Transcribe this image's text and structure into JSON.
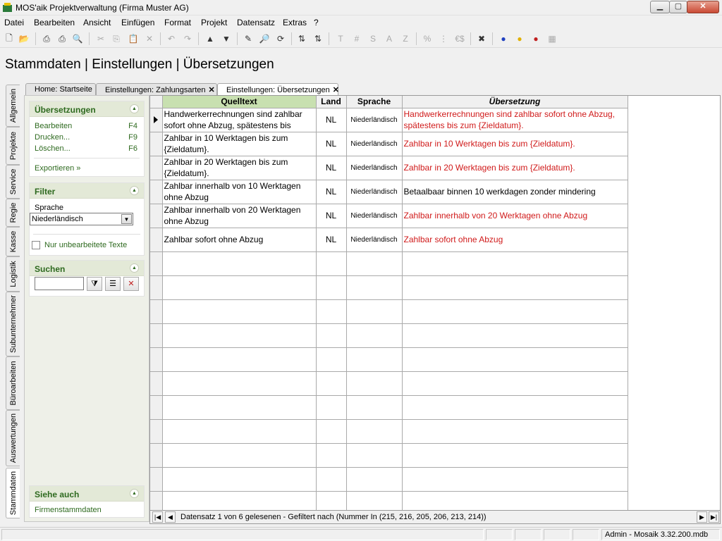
{
  "window": {
    "title": "MOS'aik Projektverwaltung (Firma Muster AG)",
    "min_icon": "minimize-icon",
    "max_icon": "maximize-icon",
    "close_icon": "close-icon"
  },
  "menu": [
    {
      "label": "Datei"
    },
    {
      "label": "Bearbeiten"
    },
    {
      "label": "Ansicht"
    },
    {
      "label": "Einfügen"
    },
    {
      "label": "Format"
    },
    {
      "label": "Projekt"
    },
    {
      "label": "Datensatz"
    },
    {
      "label": "Extras"
    },
    {
      "label": "?"
    }
  ],
  "toolbar": {
    "text_buttons": [
      "T",
      "#",
      "S",
      "A",
      "Z",
      "%",
      "€$"
    ]
  },
  "page": {
    "title": "Stammdaten | Einstellungen | Übersetzungen"
  },
  "vertical_tabs": [
    {
      "label": "Allgemein"
    },
    {
      "label": "Projekte"
    },
    {
      "label": "Service"
    },
    {
      "label": "Regie"
    },
    {
      "label": "Kasse"
    },
    {
      "label": "Logistik"
    },
    {
      "label": "Subunternehmer"
    },
    {
      "label": "Büroarbeiten"
    },
    {
      "label": "Auswertungen"
    },
    {
      "label": "Stammdaten"
    }
  ],
  "doc_tabs": [
    {
      "label": "Home: Startseite"
    },
    {
      "label": "Einstellungen: Zahlungsarten"
    },
    {
      "label": "Einstellungen: Übersetzungen"
    }
  ],
  "side": {
    "uebersetzungen": {
      "title": "Übersetzungen",
      "actions": [
        {
          "label": "Bearbeiten",
          "key": "F4"
        },
        {
          "label": "Drucken...",
          "key": "F9"
        },
        {
          "label": "Löschen...",
          "key": "F6"
        }
      ],
      "export": "Exportieren »"
    },
    "filter": {
      "title": "Filter",
      "sprache_label": "Sprache",
      "sprache_value": "Niederländisch",
      "checkbox_label": "Nur unbearbeitete Texte"
    },
    "suchen": {
      "title": "Suchen"
    },
    "siehe_auch": {
      "title": "Siehe auch",
      "link": "Firmenstammdaten"
    }
  },
  "grid": {
    "columns": [
      "Quelltext",
      "Land",
      "Sprache",
      "Übersetzung"
    ],
    "rows": [
      {
        "src": "Handwerkerrechnungen sind zahlbar sofort ohne Abzug, spätestens bis",
        "land": "NL",
        "lang": "Niederländisch",
        "trans": "Handwerkerrechnungen sind zahlbar sofort ohne Abzug, spätestens bis zum {Zieldatum}.",
        "untranslated": true
      },
      {
        "src": "Zahlbar in 10 Werktagen bis zum {Zieldatum}.",
        "land": "NL",
        "lang": "Niederländisch",
        "trans": "Zahlbar in 10 Werktagen bis zum {Zieldatum}.",
        "untranslated": true
      },
      {
        "src": "Zahlbar in 20 Werktagen bis zum {Zieldatum}.",
        "land": "NL",
        "lang": "Niederländisch",
        "trans": "Zahlbar in 20 Werktagen bis zum {Zieldatum}.",
        "untranslated": true
      },
      {
        "src": "Zahlbar innerhalb von 10 Werktagen ohne Abzug",
        "land": "NL",
        "lang": "Niederländisch",
        "trans": "Betaalbaar binnen 10 werkdagen zonder mindering",
        "untranslated": false
      },
      {
        "src": "Zahlbar innerhalb von 20 Werktagen ohne Abzug",
        "land": "NL",
        "lang": "Niederländisch",
        "trans": "Zahlbar innerhalb von 20 Werktagen ohne Abzug",
        "untranslated": true
      },
      {
        "src": "Zahlbar sofort ohne Abzug",
        "land": "NL",
        "lang": "Niederländisch",
        "trans": "Zahlbar sofort ohne Abzug",
        "untranslated": true
      }
    ],
    "status_text": "Datensatz 1 von 6 gelesenen - Gefiltert nach (Nummer In (215, 216, 205, 206, 213, 214))"
  },
  "statusbar": {
    "user": "Admin - Mosaik 3.32.200.mdb"
  },
  "colors": {
    "untranslated": "#d01a1a",
    "panel_green": "#2e6a1f"
  }
}
